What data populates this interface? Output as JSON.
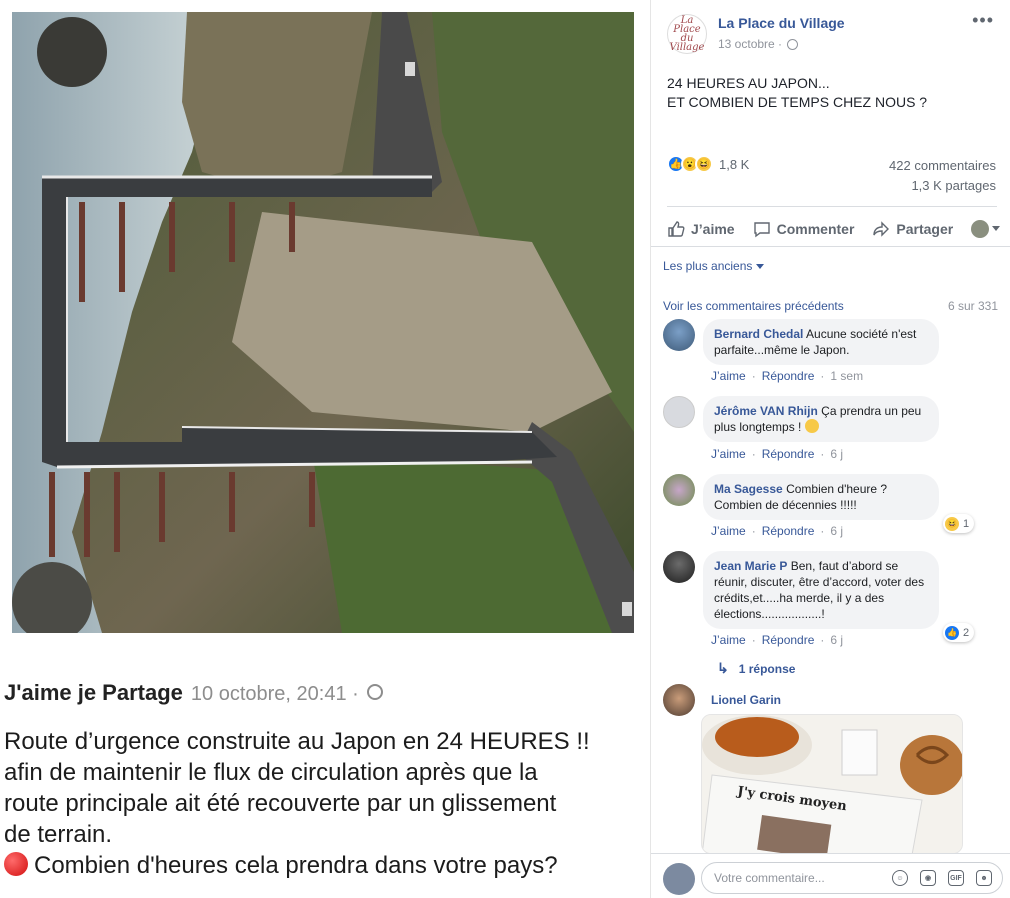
{
  "left": {
    "caption": {
      "author": "J'aime je Partage",
      "date": "10 octobre, 20:41 ·",
      "line1": "Route d’urgence construite au Japon en 24 HEURES !!",
      "line2": "afin de maintenir le flux de circulation après que la",
      "line3": "route principale ait été recouverte par un glissement",
      "line4": "de terrain.",
      "line5": "Combien d'heures cela prendra dans votre pays?"
    }
  },
  "post": {
    "page_name": "La Place du Village",
    "logo_text": "La Place du Village",
    "date": "13 octobre ·",
    "text_line1": "24 HEURES AU JAPON...",
    "text_line2": "ET COMBIEN DE TEMPS CHEZ NOUS ?",
    "reaction_count": "1,8 K",
    "comments_count": "422 commentaires",
    "shares_count": "1,3 K partages",
    "actions": {
      "like": "J’aime",
      "comment": "Commenter",
      "share": "Partager"
    },
    "sort_label": "Les plus anciens",
    "previous_label": "Voir les commentaires précédents",
    "previous_count": "6 sur 331"
  },
  "comments": [
    {
      "name": "Bernard Chedal",
      "text": "Aucune société n'est parfaite...même le Japon.",
      "like": "J’aime",
      "reply": "Répondre",
      "time": "1 sem"
    },
    {
      "name": "Jérôme VAN Rhijn",
      "text": "Ça prendra un peu plus longtemps !",
      "like": "J’aime",
      "reply": "Répondre",
      "time": "6 j"
    },
    {
      "name": "Ma Sagesse",
      "text": "Combien d'heure ? Combien de décennies !!!!!",
      "like": "J’aime",
      "reply": "Répondre",
      "time": "6 j",
      "reactions": "1"
    },
    {
      "name": "Jean Marie P",
      "text": "Ben, faut d’abord se réunir, discuter, être d’accord, voter des crédits,et.....ha merde, il y a des élections..................!",
      "like": "J’aime",
      "reply": "Répondre",
      "time": "6 j",
      "reactions": "2"
    },
    {
      "name": "Lionel Garin",
      "image_text": "J'y crois moyen"
    }
  ],
  "replies_label": "1 réponse",
  "composer": {
    "placeholder": "Votre commentaire...",
    "gif_label": "GIF"
  },
  "colors": {
    "link": "#385898",
    "like_blue": "#1877f2",
    "muted": "#90949c"
  }
}
